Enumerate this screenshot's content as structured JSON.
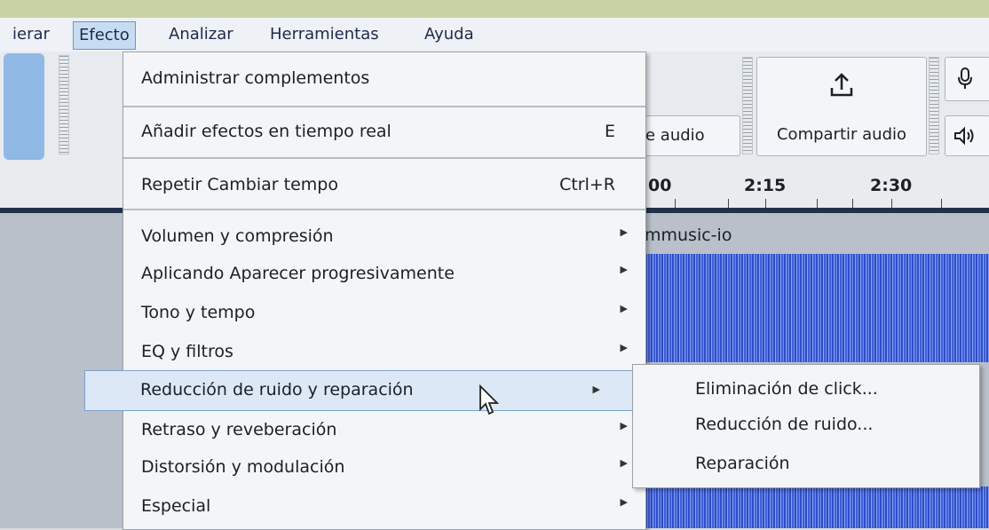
{
  "menubar": {
    "items": [
      "ierar",
      "Efecto",
      "Analizar",
      "Herramientas",
      "Ayuda"
    ]
  },
  "toolbar": {
    "audio_label_partial": "e audio",
    "share_audio_label": "Compartir audio",
    "upload_icon": "upload-icon",
    "mic_icon": "microphone-icon",
    "speaker_icon": "speaker-icon"
  },
  "timeline": {
    "labels": [
      "00",
      "2:15",
      "2:30"
    ]
  },
  "track": {
    "name": "mmusic-io"
  },
  "menu": {
    "manage_plugins": "Administrar complementos",
    "realtime_effects": {
      "label": "Añadir efectos en tiempo real",
      "shortcut": "E"
    },
    "repeat": {
      "label": "Repetir Cambiar tempo",
      "shortcut": "Ctrl+R"
    },
    "items": [
      "Volumen y compresión",
      "Aplicando Aparecer progresivamente",
      "Tono y tempo",
      "EQ y filtros",
      "Reducción de ruido y reparación",
      "Retraso y reveberación",
      "Distorsión y modulación",
      "Especial"
    ]
  },
  "submenu": {
    "items": [
      "Eliminación de click...",
      "Reducción de ruido...",
      "Reparación"
    ]
  },
  "colors": {
    "highlight": "#dce8f6",
    "waveform": "#3f5fd6"
  }
}
